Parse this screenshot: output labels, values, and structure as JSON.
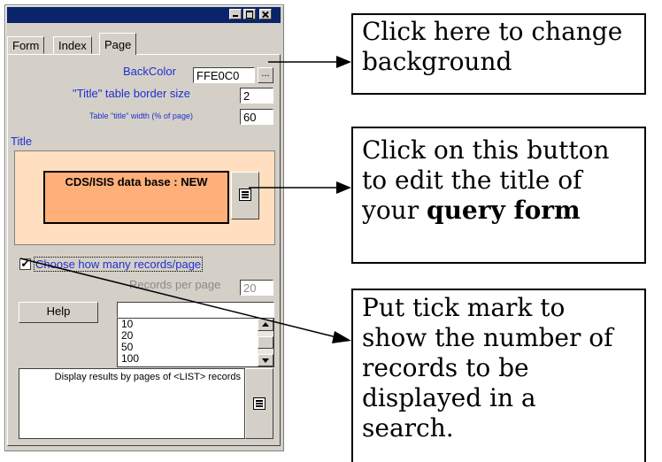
{
  "dialog": {
    "tabs": [
      "Form",
      "Index",
      "Page"
    ],
    "active_tab": "Page",
    "backcolor_label": "BackColor",
    "backcolor_value": "FFE0C0",
    "browse_button": "...",
    "border_label": "\"Title\" table border size",
    "border_value": "2",
    "width_label": "Table \"title\" width (% of page)",
    "width_value": "60",
    "title_label": "Title",
    "title_text": "CDS/ISIS data base : NEW",
    "checkbox_checked": true,
    "checkbox_label": "Choose how many records/page",
    "records_label": "Records per page",
    "records_value": "20",
    "help_button": "Help",
    "list_options": [
      "10",
      "20",
      "50",
      "100"
    ],
    "display_text": "Display results by pages of <LIST> records",
    "colors": {
      "title_bar": "#0a246a",
      "panel_bg": "#d4d0c8",
      "title_area_bg": "#ffdfc0",
      "title_box_bg": "#ffb07a",
      "label_blue": "#1f2fd0"
    }
  },
  "callouts": {
    "c1": "Click here to change background",
    "c2_before": "Click on this button to edit the title of your",
    "c2_bold": "query form",
    "c3": "Put tick mark to show the number of records to be displayed in a search."
  }
}
